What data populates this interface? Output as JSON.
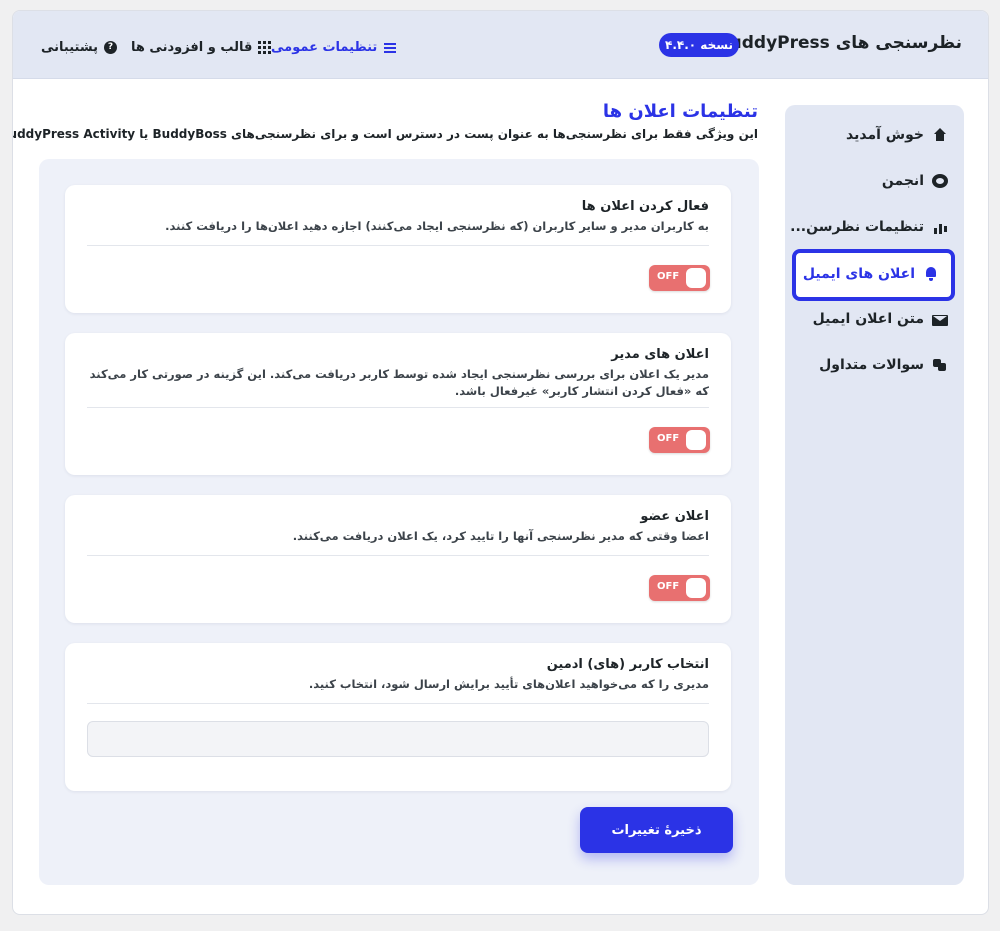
{
  "header": {
    "title": "نظرسنجی های BuddyPress",
    "version": "نسخه ۴.۴.۰",
    "nav": [
      {
        "label": "تنظیمات عمومی",
        "icon": "sliders-icon",
        "active": true
      },
      {
        "label": "قالب و افزودنی ها",
        "icon": "grid-icon",
        "active": false
      },
      {
        "label": "پشتیبانی",
        "icon": "help-icon",
        "active": false
      }
    ]
  },
  "sidebar": {
    "items": [
      {
        "label": "خوش آمدید",
        "icon": "home-icon"
      },
      {
        "label": "انجمن",
        "icon": "gear-icon"
      },
      {
        "label": "تنظیمات نظرسن...",
        "icon": "chart-icon"
      },
      {
        "label": "اعلان های ایمیل",
        "icon": "bell-icon",
        "active": true
      },
      {
        "label": "متن اعلان ایمیل",
        "icon": "mail-icon"
      },
      {
        "label": "سوالات متداول",
        "icon": "faq-icon"
      }
    ]
  },
  "main": {
    "title": "تنظیمات اعلان ها",
    "description": "این ویژگی فقط برای نظرسنجی‌ها به عنوان پست در دسترس است و برای نظرسنجی‌های BuddyBoss یا BuddyPress Activity قابل استفاده نیست.",
    "cards": [
      {
        "title": "فعال کردن اعلان ها",
        "description": "به کاربران مدیر و سایر کاربران (که نظرسنجی ایجاد می‌کنند) اجازه دهید اعلان‌ها را دریافت کنند.",
        "toggle": "OFF"
      },
      {
        "title": "اعلان های مدیر",
        "description": "مدیر یک اعلان برای بررسی نظرسنجی ایجاد شده توسط کاربر دریافت می‌کند. این گزینه در صورتی کار می‌کند که «فعال کردن انتشار کاربر» غیرفعال باشد.",
        "toggle": "OFF"
      },
      {
        "title": "اعلان عضو",
        "description": "اعضا وقتی که مدیر نظرسنجی آنها را تایید کرد، یک اعلان دریافت می‌کنند.",
        "toggle": "OFF"
      },
      {
        "title": "انتخاب کاربر (های) ادمین",
        "description": "مدیری را که می‌خواهید اعلان‌های تأیید برایش ارسال شود، انتخاب کنید."
      }
    ],
    "save_label": "ذخیرهٔ تغییرات"
  },
  "colors": {
    "accent": "#2b33e6",
    "toggle_off": "#e87070",
    "sidebar_bg": "#e2e7f3"
  }
}
